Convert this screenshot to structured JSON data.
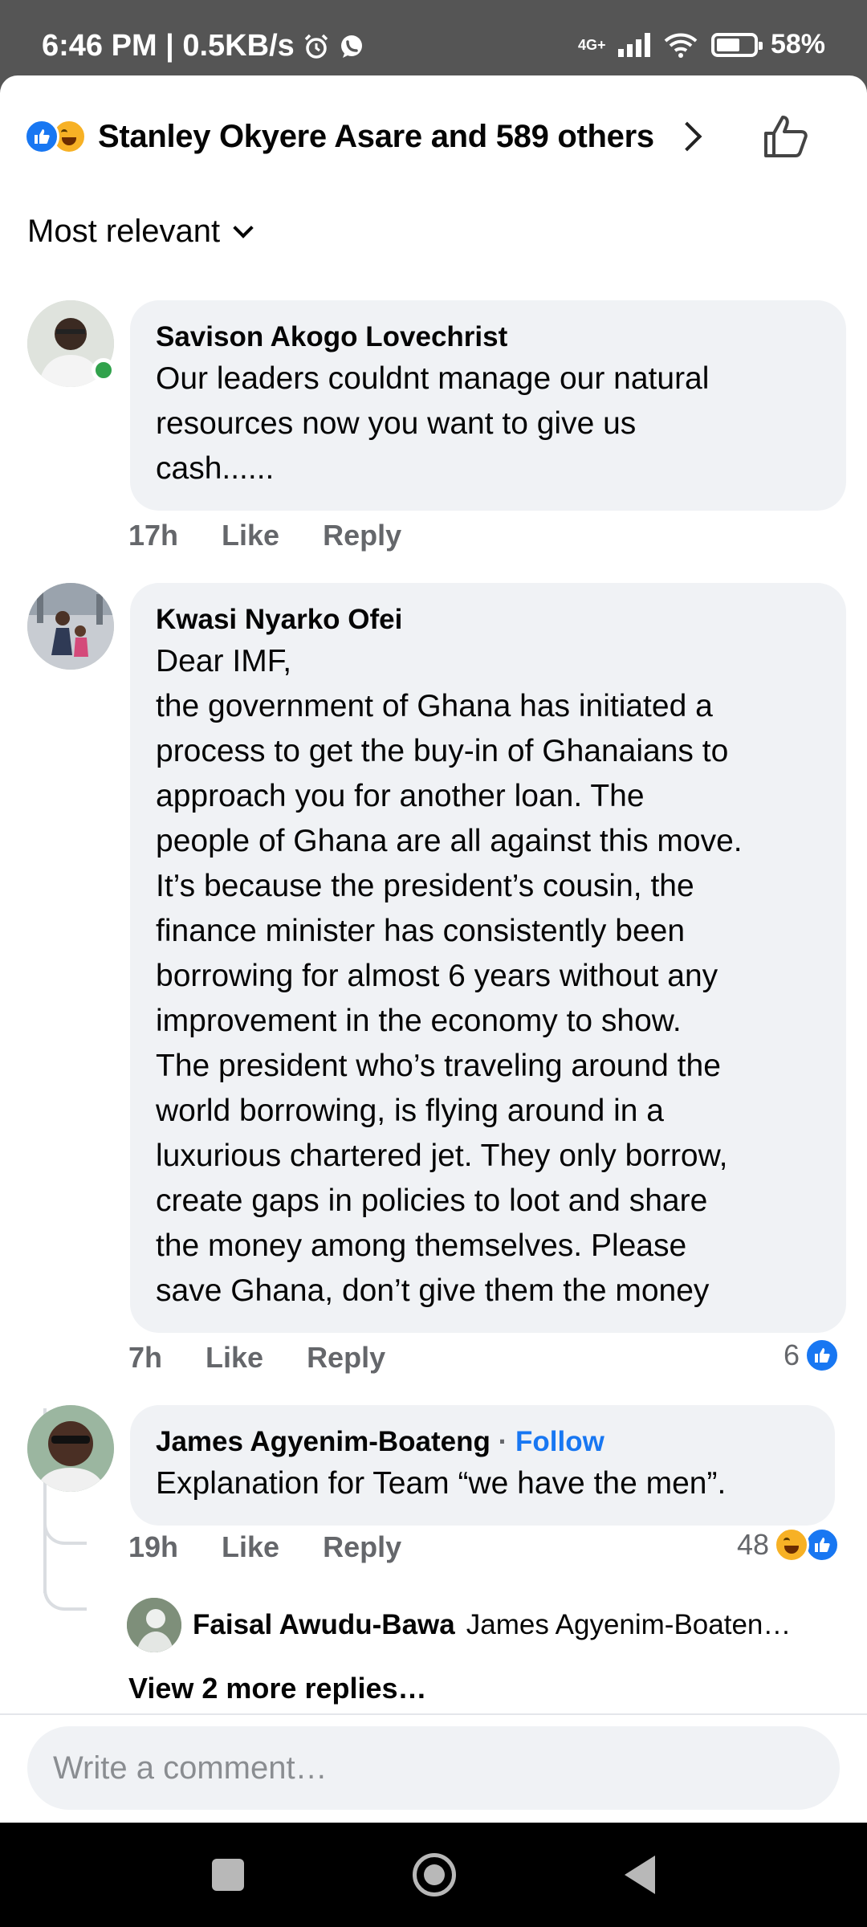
{
  "status_bar": {
    "time_speed": "6:46 PM | 0.5KB/s",
    "network_type": "4G+",
    "battery_percent": "58%",
    "icons": [
      "alarm-icon",
      "whatsapp-icon",
      "signal-icon",
      "wifi-icon",
      "battery-icon"
    ]
  },
  "header": {
    "reactors": "Stanley Okyere Asare and 589 others"
  },
  "sort": {
    "label": "Most relevant"
  },
  "comments": [
    {
      "author": "Savison Akogo Lovechrist",
      "lines": [
        "Our leaders couldnt manage our natural",
        "resources now you want to give us",
        "cash......"
      ],
      "time": "17h",
      "like": "Like",
      "reply": "Reply",
      "online": true
    },
    {
      "author": "Kwasi Nyarko Ofei",
      "lines": [
        "Dear IMF,",
        "the government of Ghana has initiated a",
        "process to get the buy-in of Ghanaians to",
        "approach you for another loan. The",
        "people of Ghana are all against this move.",
        "It’s because the president’s cousin, the",
        "finance minister has consistently been",
        "borrowing for almost 6 years without any",
        "improvement in the economy to show.",
        "The president who’s traveling around the",
        "world borrowing, is flying around in a",
        "luxurious chartered jet. They only borrow,",
        "create gaps in policies to loot and share",
        "the money among themselves. Please",
        "save Ghana, don’t give them the money"
      ],
      "time": "7h",
      "like": "Like",
      "reply": "Reply",
      "reaction_count": "6"
    },
    {
      "author": "James Agyenim-Boateng",
      "separator": "·",
      "follow": "Follow",
      "lines": [
        "Explanation for Team “we have the men”."
      ],
      "time": "19h",
      "like": "Like",
      "reply": "Reply",
      "reaction_count": "48",
      "reply_preview": {
        "author": "Faisal Awudu-Bawa",
        "text": "James Agyenim-Boaten…"
      },
      "view_more": "View 2 more replies…"
    }
  ],
  "composer": {
    "placeholder": "Write a comment…"
  },
  "colors": {
    "facebook_blue": "#1877f2",
    "bubble_gray": "#f0f2f5",
    "meta_gray": "#65676b",
    "online_green": "#31a24c",
    "status_bar": "#555555"
  }
}
